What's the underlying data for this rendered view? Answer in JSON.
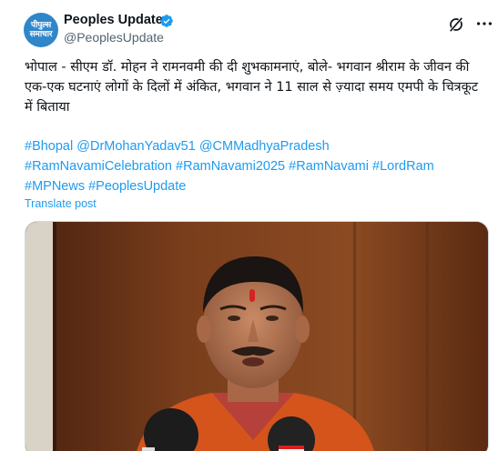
{
  "post": {
    "author": {
      "avatar_text_line1": "पीपुल्स",
      "avatar_text_line2": "समाचार",
      "display_name": "Peoples Update",
      "handle": "@PeoplesUpdate"
    },
    "text": "भोपाल - सीएम डॉ. मोहन ने रामनवमी की दी शुभकामनाएं, बोले- भगवान श्रीराम के जीवन की एक-एक घटनाएं लोगों के दिलों में अंकित, भगवान ने 11 साल से ज़्यादा समय एमपी के चित्रकूट में बिताया",
    "hashtags": [
      "#Bhopal",
      "@DrMohanYadav51",
      "@CMMadhyaPradesh",
      "#RamNavamiCelebration",
      "#RamNavami2025",
      "#RamNavami",
      "#LordRam",
      "#MPNews",
      "#PeoplesUpdate"
    ],
    "translate_label": "Translate post"
  },
  "icons": {
    "verified": "verified-badge-icon",
    "grok": "grok-icon",
    "more": "more-options-icon"
  },
  "colors": {
    "accent": "#1d9bf0",
    "text": "#0f1419",
    "muted": "#536471"
  }
}
